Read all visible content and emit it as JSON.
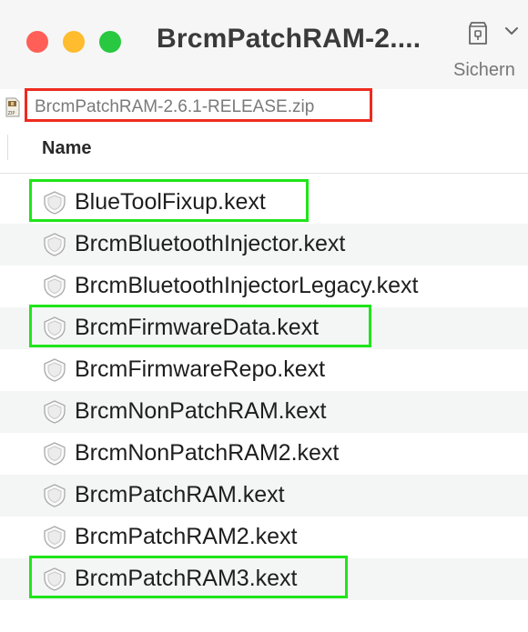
{
  "window": {
    "title": "BrcmPatchRAM-2....",
    "toolbar": {
      "share_label": "Sichern",
      "share_icon": "archive-lock-icon"
    }
  },
  "pathbar": {
    "icon": "zip-archive-icon",
    "path": "BrcmPatchRAM-2.6.1-RELEASE.zip"
  },
  "columns": {
    "name": "Name"
  },
  "files": [
    {
      "name": "BlueToolFixup.kext",
      "icon": "kext-icon",
      "highlighted": true
    },
    {
      "name": "BrcmBluetoothInjector.kext",
      "icon": "kext-icon",
      "highlighted": false
    },
    {
      "name": "BrcmBluetoothInjectorLegacy.kext",
      "icon": "kext-icon",
      "highlighted": false
    },
    {
      "name": "BrcmFirmwareData.kext",
      "icon": "kext-icon",
      "highlighted": true
    },
    {
      "name": "BrcmFirmwareRepo.kext",
      "icon": "kext-icon",
      "highlighted": false
    },
    {
      "name": "BrcmNonPatchRAM.kext",
      "icon": "kext-icon",
      "highlighted": false
    },
    {
      "name": "BrcmNonPatchRAM2.kext",
      "icon": "kext-icon",
      "highlighted": false
    },
    {
      "name": "BrcmPatchRAM.kext",
      "icon": "kext-icon",
      "highlighted": false
    },
    {
      "name": "BrcmPatchRAM2.kext",
      "icon": "kext-icon",
      "highlighted": false
    },
    {
      "name": "BrcmPatchRAM3.kext",
      "icon": "kext-icon",
      "highlighted": true
    }
  ],
  "colors": {
    "highlight_red": "#ee2a1f",
    "highlight_green": "#1fe51a",
    "close": "#ff5f57",
    "minimize": "#febc2e",
    "maximize": "#28c840"
  }
}
